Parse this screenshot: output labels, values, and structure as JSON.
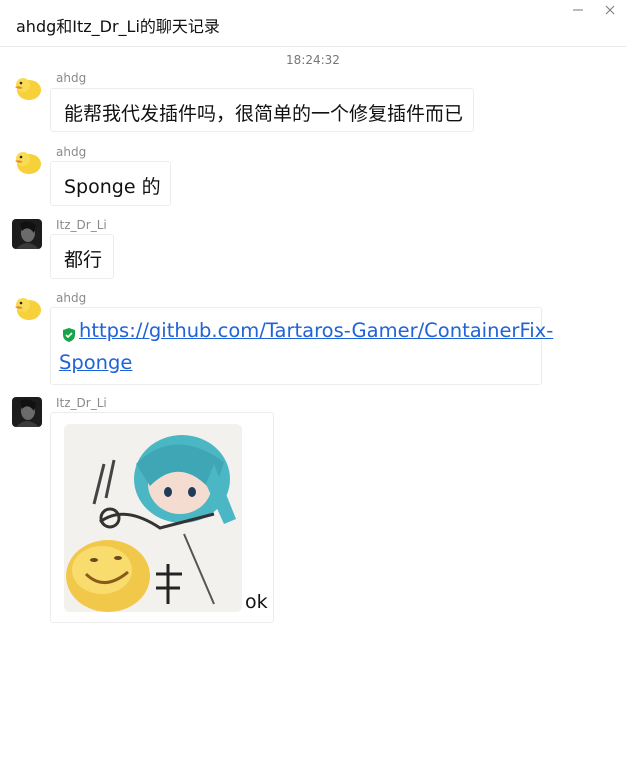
{
  "window": {
    "title": "ahdg和Itz_Dr_Li的聊天记录",
    "minimize_icon": "minimize-icon",
    "close_icon": "close-icon"
  },
  "timestamp": "18:24:32",
  "messages": [
    {
      "sender": "ahdg",
      "avatar": "duck-avatar",
      "text": "能帮我代发插件吗，很简单的一个修复插件而已"
    },
    {
      "sender": "ahdg",
      "avatar": "duck-avatar",
      "text": "Sponge 的"
    },
    {
      "sender": "Itz_Dr_Li",
      "avatar": "dark-portrait-avatar",
      "text": "都行"
    },
    {
      "sender": "ahdg",
      "avatar": "duck-avatar",
      "link_icon": "shield-check-icon",
      "link_line1": "https://github.com/Tartaros-Gamer/ContainerFix-",
      "link_line2": "Sponge"
    },
    {
      "sender": "Itz_Dr_Li",
      "avatar": "dark-portrait-avatar",
      "sticker": "sticker-image",
      "text": "ok"
    }
  ],
  "colors": {
    "link": "#1f63d8",
    "shield": "#1aa34a",
    "duck": "#f7d13a"
  }
}
